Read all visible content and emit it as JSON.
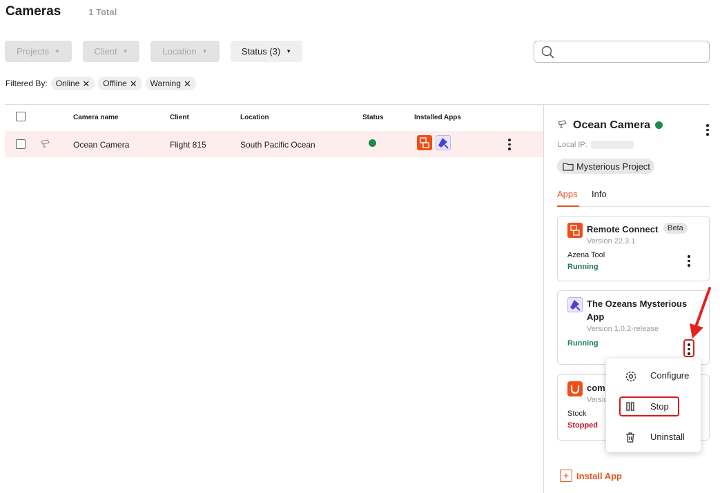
{
  "header": {
    "title": "Cameras",
    "total": "1 Total"
  },
  "filters": {
    "projects": "Projects",
    "client": "Client",
    "location": "Location",
    "status": "Status (3)"
  },
  "search": {
    "placeholder": ""
  },
  "filtered_by": {
    "label": "Filtered By:",
    "chips": [
      "Online",
      "Offline",
      "Warning"
    ]
  },
  "table": {
    "columns": [
      "Camera name",
      "Client",
      "Location",
      "Status",
      "Installed Apps"
    ],
    "rows": [
      {
        "camera_name": "Ocean Camera",
        "client": "Flight 815",
        "location": "South Pacific Ocean",
        "status": "online"
      }
    ]
  },
  "panel": {
    "camera_name": "Ocean Camera",
    "local_ip_label": "Local IP:",
    "project": "Mysterious Project",
    "tabs": [
      "Apps",
      "Info"
    ],
    "apps": [
      {
        "name": "Remote Connect",
        "badge": "Beta",
        "version": "Version 22.3.1",
        "tool": "Azena Tool",
        "state": "Running"
      },
      {
        "name_line1": "The Ozeans Mysterious",
        "name_line2": "App",
        "version": "Version 1.0.2-release",
        "state": "Running"
      },
      {
        "name": "com",
        "version": "Versio",
        "tool": "Stock",
        "state": "Stopped"
      }
    ],
    "install_label": "Install App"
  },
  "context_menu": {
    "items": [
      "Configure",
      "Stop",
      "Uninstall"
    ]
  },
  "colors": {
    "accent": "#e8541e",
    "running": "#1e7e54",
    "stopped": "#c8102e",
    "highlight": "#d81a1a",
    "row_selected": "#fdeeed"
  }
}
